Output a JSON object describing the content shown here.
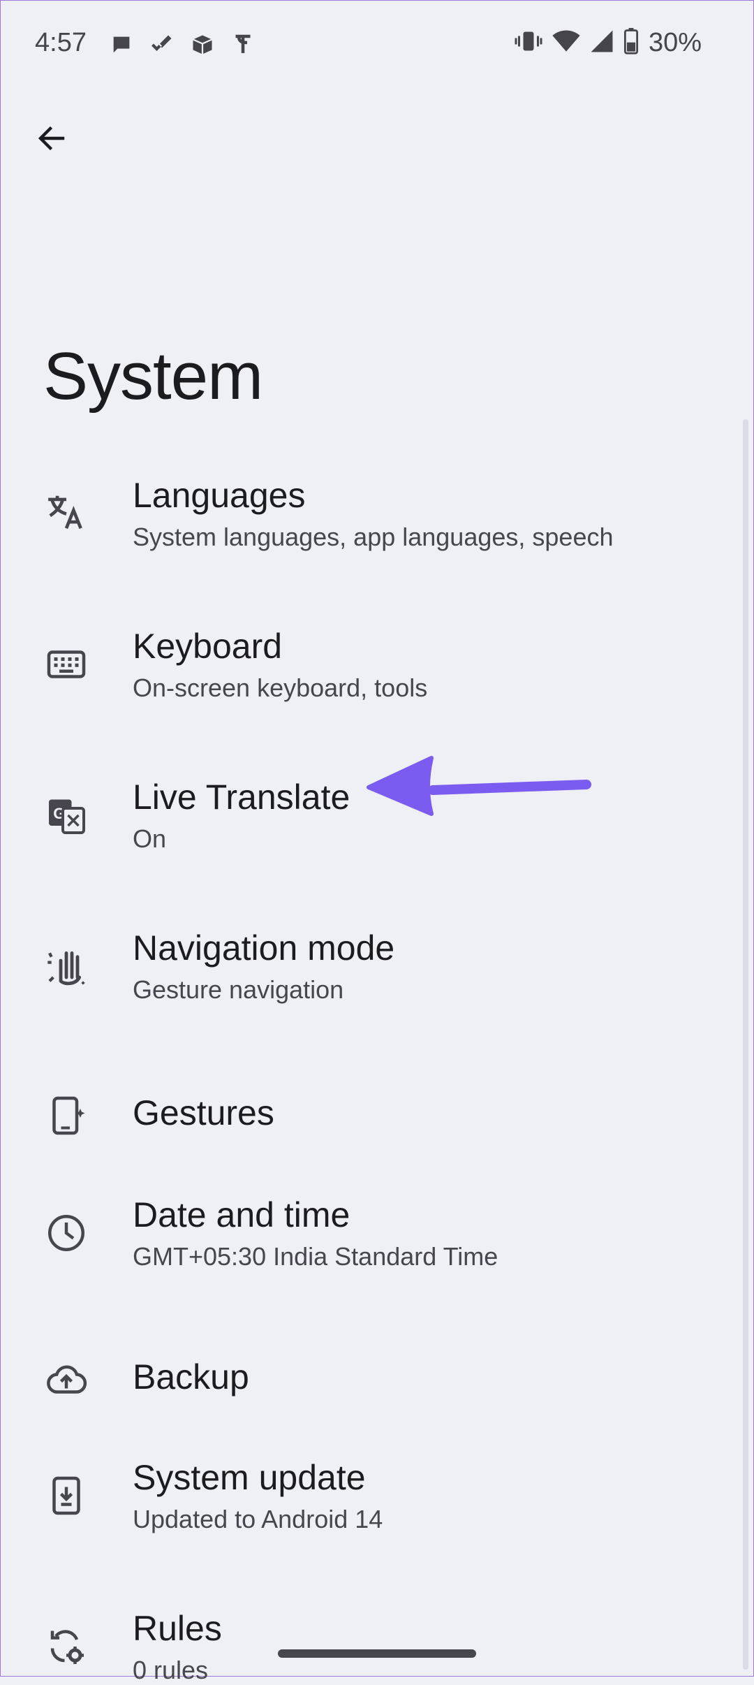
{
  "status_bar": {
    "time": "4:57",
    "battery": "30%",
    "left_icons": [
      "chat-bubble-icon",
      "check-mark-icon",
      "box-icon",
      "phonepe-icon"
    ],
    "right_icons": [
      "vibrate-icon",
      "wifi-icon",
      "signal-icon",
      "battery-icon"
    ]
  },
  "header": {
    "back_icon": "arrow-back-icon",
    "title": "System"
  },
  "items": [
    {
      "icon": "translate-icon",
      "label": "Languages",
      "sub": "System languages, app languages, speech"
    },
    {
      "icon": "keyboard-icon",
      "label": "Keyboard",
      "sub": "On-screen keyboard, tools"
    },
    {
      "icon": "live-translate-icon",
      "label": "Live Translate",
      "sub": "On"
    },
    {
      "icon": "gesture-hand-icon",
      "label": "Navigation mode",
      "sub": "Gesture navigation"
    },
    {
      "icon": "phone-sparkle-icon",
      "label": "Gestures",
      "sub": ""
    },
    {
      "icon": "clock-icon",
      "label": "Date and time",
      "sub": "GMT+05:30 India Standard Time"
    },
    {
      "icon": "cloud-upload-icon",
      "label": "Backup",
      "sub": ""
    },
    {
      "icon": "system-update-icon",
      "label": "System update",
      "sub": "Updated to Android 14"
    },
    {
      "icon": "rules-icon",
      "label": "Rules",
      "sub": "0 rules"
    }
  ],
  "annotation": {
    "color": "#7b5cf0",
    "icon": "pointer-arrow-icon"
  }
}
